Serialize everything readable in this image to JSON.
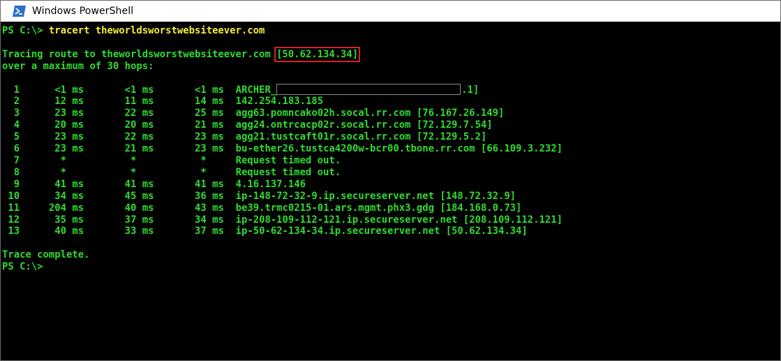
{
  "window": {
    "title": "Windows PowerShell",
    "icon": "powershell-icon",
    "colors": {
      "text": "#2fdc2f",
      "command": "#f2ee3a",
      "highlight_box": "#d4202a",
      "background": "#000000"
    }
  },
  "console": {
    "prompt1": "PS C:\\> ",
    "command": "tracert theworldsworstwebsiteever.com",
    "tracing_prefix": "Tracing route to theworldsworstwebsiteever.com ",
    "tracing_ip": "[50.62.134.34]",
    "max_hops": "over a maximum of 30 hops:",
    "hops": [
      {
        "num": "1",
        "t1": "<1",
        "t2": "<1",
        "t3": "<1",
        "host": "ARCHER_",
        "suffix": ".1]",
        "redacted": true
      },
      {
        "num": "2",
        "t1": "12",
        "t2": "11",
        "t3": "14",
        "host": "142.254.183.185"
      },
      {
        "num": "3",
        "t1": "23",
        "t2": "22",
        "t3": "25",
        "host": "agg63.pomncako02h.socal.rr.com [76.167.26.149]"
      },
      {
        "num": "4",
        "t1": "20",
        "t2": "20",
        "t3": "21",
        "host": "agg24.ontrcacp02r.socal.rr.com [72.129.7.54]"
      },
      {
        "num": "5",
        "t1": "23",
        "t2": "22",
        "t3": "23",
        "host": "agg21.tustcaft01r.socal.rr.com [72.129.5.2]"
      },
      {
        "num": "6",
        "t1": "23",
        "t2": "21",
        "t3": "23",
        "host": "bu-ether26.tustca4200w-bcr00.tbone.rr.com [66.109.3.232]"
      },
      {
        "num": "7",
        "t1": "*",
        "t2": "*",
        "t3": "*",
        "host": "Request timed out.",
        "timeout": true
      },
      {
        "num": "8",
        "t1": "*",
        "t2": "*",
        "t3": "*",
        "host": "Request timed out.",
        "timeout": true
      },
      {
        "num": "9",
        "t1": "41",
        "t2": "41",
        "t3": "41",
        "host": "4.16.137.146"
      },
      {
        "num": "10",
        "t1": "34",
        "t2": "45",
        "t3": "36",
        "host": "ip-148-72-32-9.ip.secureserver.net [148.72.32.9]"
      },
      {
        "num": "11",
        "t1": "204",
        "t2": "40",
        "t3": "43",
        "host": "be39.trmc0215-01.ars.mgmt.phx3.gdg [184.168.0.73]"
      },
      {
        "num": "12",
        "t1": "35",
        "t2": "37",
        "t3": "34",
        "host": "ip-208-109-112-121.ip.secureserver.net [208.109.112.121]"
      },
      {
        "num": "13",
        "t1": "40",
        "t2": "33",
        "t3": "37",
        "host": "ip-50-62-134-34.ip.secureserver.net [50.62.134.34]"
      }
    ],
    "unit": "ms",
    "complete": "Trace complete.",
    "prompt2": "PS C:\\>"
  }
}
